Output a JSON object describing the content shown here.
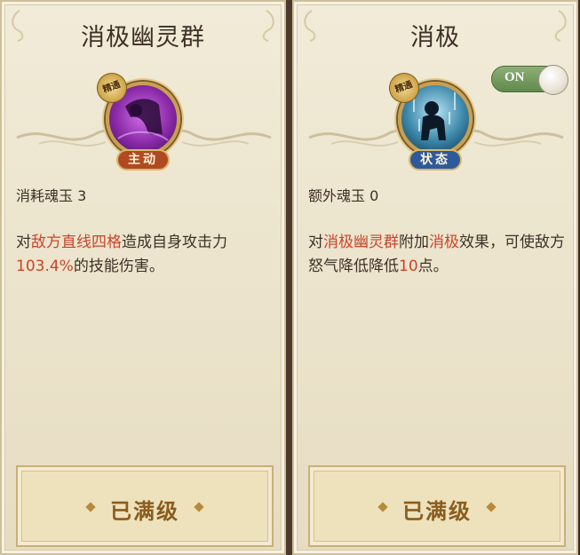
{
  "skills": [
    {
      "title": "消极幽灵群",
      "mastery_badge": "精通",
      "type_badge": "主动",
      "cost_label": "消耗魂玉",
      "cost_value": "3",
      "desc_parts": [
        "对",
        "敌方直线四格",
        "造成自身攻击力",
        "103.4%",
        "的技能伤害。"
      ],
      "max_label": "已满级",
      "icon": "ghost-figure-icon"
    },
    {
      "title": "消极",
      "mastery_badge": "精通",
      "type_badge": "状态",
      "cost_label": "额外魂玉",
      "cost_value": "0",
      "toggle_label": "ON",
      "desc_parts": [
        "对",
        "消极幽灵群",
        "附加",
        "消极",
        "效果，可使敌方怒气降低降低",
        "10",
        "点。"
      ],
      "max_label": "已满级",
      "icon": "slumped-figure-icon"
    }
  ],
  "colors": {
    "highlight": "#c9452a",
    "active_badge": "#b04a22",
    "state_badge": "#2f5a9a",
    "toggle_on": "#6f9a58"
  }
}
